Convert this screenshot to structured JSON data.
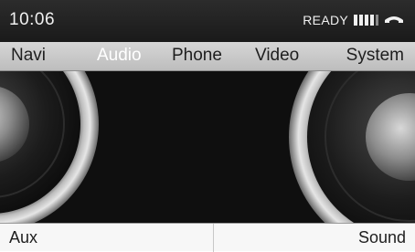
{
  "status": {
    "time": "10:06",
    "ready": "READY",
    "signal_icon": "signal-strength-icon",
    "phone_icon": "phone-handset-icon"
  },
  "menu": {
    "tabs": [
      {
        "label": "Navi",
        "active": false
      },
      {
        "label": "Audio",
        "active": true
      },
      {
        "label": "Phone",
        "active": false
      },
      {
        "label": "Video",
        "active": false
      },
      {
        "label": "System",
        "active": false
      }
    ]
  },
  "main": {
    "graphic": "speaker-icon"
  },
  "softkeys": {
    "left": "Aux",
    "right": "Sound"
  },
  "colors": {
    "active_tab": "#ffffff",
    "menu_background": "#c8c8c8",
    "status_background": "#222222"
  }
}
